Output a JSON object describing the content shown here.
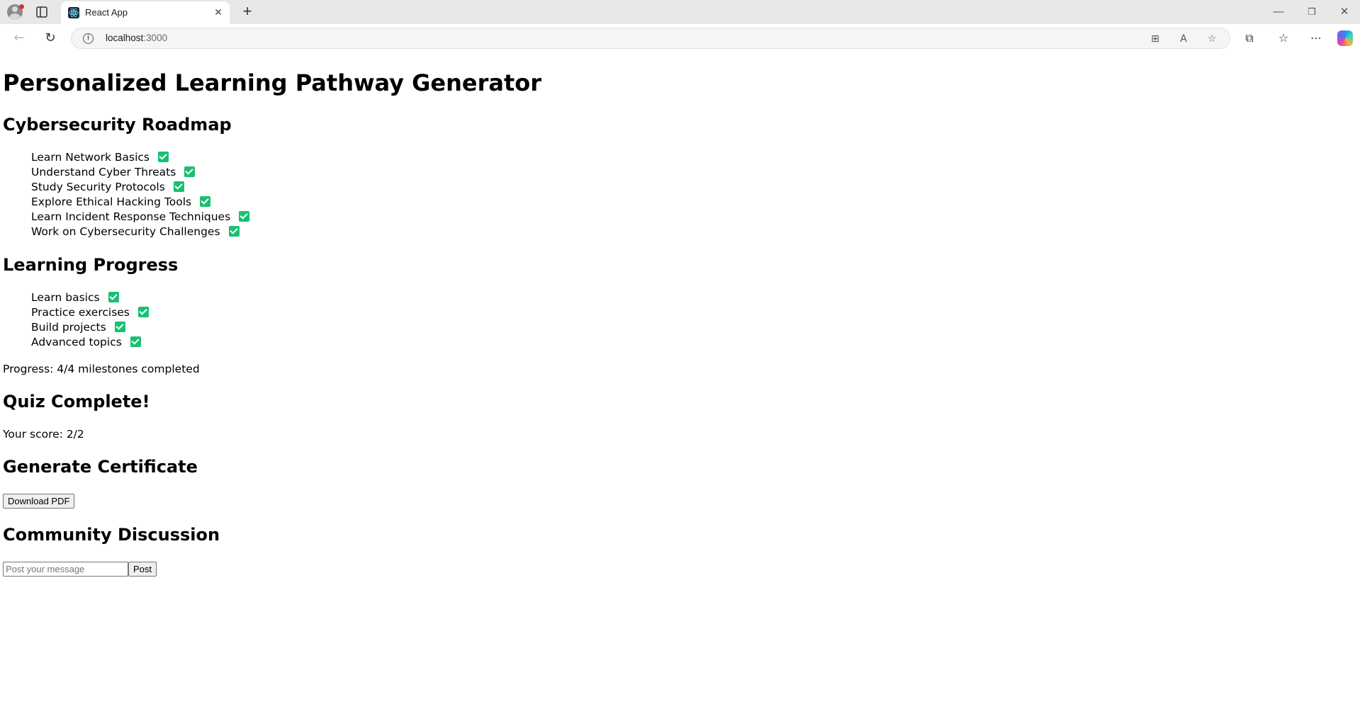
{
  "browser": {
    "tab_title": "React App",
    "url_host": "localhost",
    "url_port": ":3000"
  },
  "page": {
    "title": "Personalized Learning Pathway Generator",
    "roadmap": {
      "heading": "Cybersecurity Roadmap",
      "items": [
        {
          "label": "Learn Network Basics",
          "checked": true
        },
        {
          "label": "Understand Cyber Threats",
          "checked": true
        },
        {
          "label": "Study Security Protocols",
          "checked": true
        },
        {
          "label": "Explore Ethical Hacking Tools",
          "checked": true
        },
        {
          "label": "Learn Incident Response Techniques",
          "checked": true
        },
        {
          "label": "Work on Cybersecurity Challenges",
          "checked": true
        }
      ]
    },
    "progress": {
      "heading": "Learning Progress",
      "items": [
        {
          "label": "Learn basics",
          "checked": true
        },
        {
          "label": "Practice exercises",
          "checked": true
        },
        {
          "label": "Build projects",
          "checked": true
        },
        {
          "label": "Advanced topics",
          "checked": true
        }
      ],
      "summary": "Progress: 4/4 milestones completed"
    },
    "quiz": {
      "heading": "Quiz Complete!",
      "score_text": "Your score: 2/2"
    },
    "certificate": {
      "heading": "Generate Certificate",
      "button_label": "Download PDF"
    },
    "community": {
      "heading": "Community Discussion",
      "input_placeholder": "Post your message",
      "input_value": "",
      "button_label": "Post"
    }
  },
  "icons": {
    "check_color": "#16c172"
  }
}
